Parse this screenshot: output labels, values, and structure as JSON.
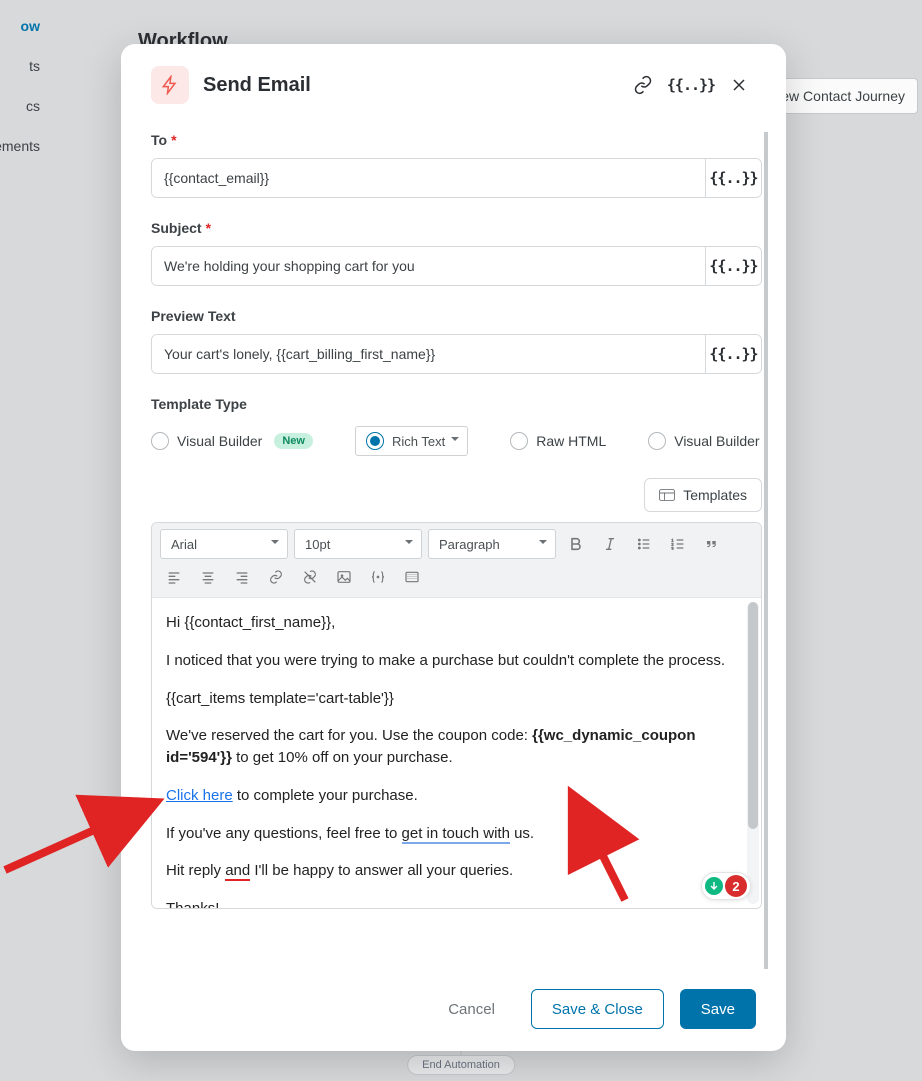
{
  "page": {
    "title": "Workflow",
    "journey_btn": "ew Contact Journey",
    "end_automation": "End Automation"
  },
  "sidenav": [
    {
      "label": "ow",
      "active": true
    },
    {
      "label": "ts",
      "active": false
    },
    {
      "label": "cs",
      "active": false
    },
    {
      "label": "ements",
      "active": false
    }
  ],
  "modal": {
    "title": "Send Email",
    "fields": {
      "to": {
        "label": "To",
        "required": true,
        "value": "{{contact_email}}"
      },
      "subject": {
        "label": "Subject",
        "required": true,
        "value": "We're holding your shopping cart for you"
      },
      "preview": {
        "label": "Preview Text",
        "required": false,
        "value": "Your cart's lonely, {{cart_billing_first_name}}"
      }
    },
    "template_type": {
      "label": "Template Type",
      "options": [
        {
          "key": "visual_new",
          "label": "Visual Builder",
          "badge": "New",
          "selected": false
        },
        {
          "key": "rich_text",
          "label": "Rich Text",
          "selected": true
        },
        {
          "key": "raw_html",
          "label": "Raw HTML",
          "selected": false
        },
        {
          "key": "visual",
          "label": "Visual Builder",
          "selected": false
        }
      ]
    },
    "templates_btn": "Templates",
    "editor": {
      "font": "Arial",
      "size": "10pt",
      "block": "Paragraph",
      "content": {
        "greeting": "Hi {{contact_first_name}},",
        "line1": "I noticed that you were trying to make a purchase but couldn't complete the process.",
        "cart_items": "{{cart_items template='cart-table'}}",
        "reserved_pre": "We've reserved the cart for you. Use the coupon code: ",
        "coupon": "{{wc_dynamic_coupon id='594'}}",
        "reserved_post": " to get 10% off on your purchase.",
        "click_here": "Click here",
        "click_post": " to complete your purchase.",
        "questions_pre": "If you've any questions, feel free to ",
        "get_in_touch": "get in touch with",
        "questions_post": " us.",
        "reply_pre": "Hit reply ",
        "and": "and",
        "reply_post": " I'll be happy to answer all your queries.",
        "thanks": "Thanks!"
      },
      "grammar_count": "2"
    },
    "buttons": {
      "cancel": "Cancel",
      "save_close": "Save & Close",
      "save": "Save"
    }
  }
}
